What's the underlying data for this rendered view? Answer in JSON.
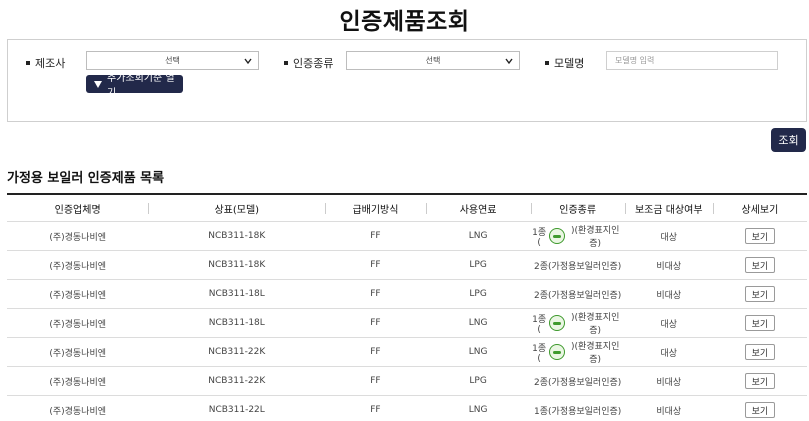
{
  "page_title": "인증제품조회",
  "search": {
    "manufacturer_label": "제조사",
    "manufacturer_value": "선택",
    "cert_type_label": "인증종류",
    "cert_type_value": "선택",
    "model_label": "모델명",
    "model_placeholder": "모델명 입력",
    "toggle_label": "추가조회기준 열기",
    "search_button": "조회"
  },
  "section_title": "가정용 보일러 인증제품 목록",
  "table": {
    "headers": [
      "인증업체명",
      "상표(모델)",
      "급배기방식",
      "사용연료",
      "인증종류",
      "보조금 대상여부",
      "상세보기"
    ],
    "rows": [
      {
        "company": "(주)경동나비엔",
        "model": "NCB311-18K",
        "exhaust": "FF",
        "fuel": "LNG",
        "cert_prefix": "1종(",
        "cert_suffix": ")(환경표지인증)",
        "eco": true,
        "subsidy": "대상",
        "detail": "보기"
      },
      {
        "company": "(주)경동나비엔",
        "model": "NCB311-18K",
        "exhaust": "FF",
        "fuel": "LPG",
        "cert_prefix": "2종(가정용보일러인증)",
        "cert_suffix": "",
        "eco": false,
        "subsidy": "비대상",
        "detail": "보기"
      },
      {
        "company": "(주)경동나비엔",
        "model": "NCB311-18L",
        "exhaust": "FF",
        "fuel": "LPG",
        "cert_prefix": "2종(가정용보일러인증)",
        "cert_suffix": "",
        "eco": false,
        "subsidy": "비대상",
        "detail": "보기"
      },
      {
        "company": "(주)경동나비엔",
        "model": "NCB311-18L",
        "exhaust": "FF",
        "fuel": "LNG",
        "cert_prefix": "1종(",
        "cert_suffix": ")(환경표지인증)",
        "eco": true,
        "subsidy": "대상",
        "detail": "보기"
      },
      {
        "company": "(주)경동나비엔",
        "model": "NCB311-22K",
        "exhaust": "FF",
        "fuel": "LNG",
        "cert_prefix": "1종(",
        "cert_suffix": ")(환경표지인증)",
        "eco": true,
        "subsidy": "대상",
        "detail": "보기"
      },
      {
        "company": "(주)경동나비엔",
        "model": "NCB311-22K",
        "exhaust": "FF",
        "fuel": "LPG",
        "cert_prefix": "2종(가정용보일러인증)",
        "cert_suffix": "",
        "eco": false,
        "subsidy": "비대상",
        "detail": "보기"
      },
      {
        "company": "(주)경동나비엔",
        "model": "NCB311-22L",
        "exhaust": "FF",
        "fuel": "LNG",
        "cert_prefix": "1종(가정용보일러인증)",
        "cert_suffix": "",
        "eco": false,
        "subsidy": "비대상",
        "detail": "보기"
      }
    ]
  }
}
